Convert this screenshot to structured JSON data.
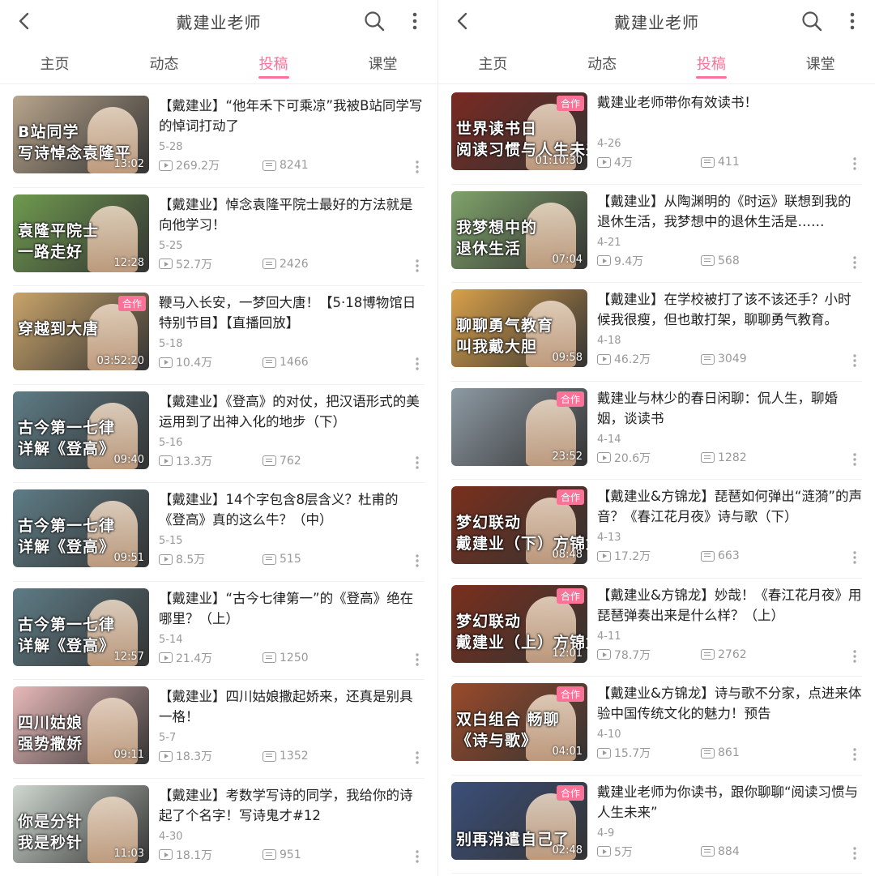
{
  "panels": [
    {
      "header": {
        "title": "戴建业老师"
      },
      "tabs": [
        "主页",
        "动态",
        "投稿",
        "课堂"
      ],
      "active_tab": 2,
      "videos": [
        {
          "title": "【戴建业】“他年禾下可乘凉”我被B站同学写的悼词打动了",
          "date": "5-28",
          "views": "269.2万",
          "danmaku": "8241",
          "duration": "13:02",
          "coop": "",
          "overlay1": "B站同学",
          "overlay2": "写诗悼念袁隆平",
          "bg": "#b8a58c"
        },
        {
          "title": "【戴建业】悼念袁隆平院士最好的方法就是向他学习！",
          "date": "5-25",
          "views": "52.7万",
          "danmaku": "2426",
          "duration": "12:28",
          "coop": "",
          "overlay1": "袁隆平院士",
          "overlay2": "一路走好",
          "bg": "#6f9a4f"
        },
        {
          "title": "鞭马入长安，一梦回大唐！【5·18博物馆日特别节目】【直播回放】",
          "date": "5-18",
          "views": "10.4万",
          "danmaku": "1466",
          "duration": "03:52:20",
          "coop": "合作",
          "overlay1": "穿越到大唐",
          "overlay2": "",
          "bg": "#c9a46a"
        },
        {
          "title": "【戴建业】《登高》的对仗，把汉语形式的美运用到了出神入化的地步（下）",
          "date": "5-16",
          "views": "13.3万",
          "danmaku": "762",
          "duration": "09:40",
          "coop": "",
          "overlay1": "古今第一七律",
          "overlay2": "详解《登高》",
          "bg": "#5e7c86"
        },
        {
          "title": "【戴建业】14个字包含8层含义？杜甫的《登高》真的这么牛？（中）",
          "date": "5-15",
          "views": "8.5万",
          "danmaku": "515",
          "duration": "09:51",
          "coop": "",
          "overlay1": "古今第一七律",
          "overlay2": "详解《登高》",
          "bg": "#5e7c86"
        },
        {
          "title": "【戴建业】“古今七律第一”的《登高》绝在哪里？（上）",
          "date": "5-14",
          "views": "21.4万",
          "danmaku": "1250",
          "duration": "12:57",
          "coop": "",
          "overlay1": "古今第一七律",
          "overlay2": "详解《登高》",
          "bg": "#5e7c86"
        },
        {
          "title": "【戴建业】四川姑娘撒起娇来，还真是别具一格！",
          "date": "5-7",
          "views": "18.3万",
          "danmaku": "1352",
          "duration": "09:11",
          "coop": "",
          "overlay1": "四川姑娘",
          "overlay2": "强势撒娇",
          "bg": "#e8b9b9"
        },
        {
          "title": "【戴建业】考数学写诗的同学，我给你的诗起了个名字！写诗鬼才#12",
          "date": "4-30",
          "views": "18.1万",
          "danmaku": "951",
          "duration": "11:03",
          "coop": "",
          "overlay1": "你是分针",
          "overlay2": "我是秒针",
          "bg": "#cfd8d0"
        }
      ]
    },
    {
      "header": {
        "title": "戴建业老师"
      },
      "tabs": [
        "主页",
        "动态",
        "投稿",
        "课堂"
      ],
      "active_tab": 2,
      "videos": [
        {
          "title": "戴建业老师带你有效读书！",
          "date": "4-26",
          "views": "4万",
          "danmaku": "411",
          "duration": "01:10:30",
          "coop": "合作",
          "overlay1": "世界读书日",
          "overlay2": "阅读习惯与人生未来",
          "bg": "#7a2a22"
        },
        {
          "title": "【戴建业】从陶渊明的《时运》联想到我的退休生活，我梦想中的退休生活是……",
          "date": "4-21",
          "views": "9.4万",
          "danmaku": "568",
          "duration": "07:04",
          "coop": "",
          "overlay1": "我梦想中的",
          "overlay2": "退休生活",
          "bg": "#7fa36a"
        },
        {
          "title": "【戴建业】在学校被打了该不该还手？小时候我很瘦，但也敢打架，聊聊勇气教育。",
          "date": "4-18",
          "views": "46.2万",
          "danmaku": "3049",
          "duration": "09:58",
          "coop": "",
          "overlay1": "聊聊勇气教育",
          "overlay2": "叫我戴大胆",
          "bg": "#d9a04a"
        },
        {
          "title": "戴建业与林少的春日闲聊：侃人生，聊婚姻，谈读书",
          "date": "4-14",
          "views": "20.6万",
          "danmaku": "1282",
          "duration": "23:52",
          "coop": "合作",
          "overlay1": "",
          "overlay2": "",
          "bg": "#8d9aa3"
        },
        {
          "title": "【戴建业&方锦龙】琵琶如何弹出“涟漪”的声音？《春江花月夜》诗与歌（下）",
          "date": "4-13",
          "views": "17.2万",
          "danmaku": "663",
          "duration": "08:48",
          "coop": "合作",
          "overlay1": "梦幻联动",
          "overlay2": "戴建业（下）方锦龙",
          "bg": "#7a2f1c"
        },
        {
          "title": "【戴建业&方锦龙】妙哉！《春江花月夜》用琵琶弹奏出来是什么样？（上）",
          "date": "4-11",
          "views": "78.7万",
          "danmaku": "2762",
          "duration": "12:01",
          "coop": "合作",
          "overlay1": "梦幻联动",
          "overlay2": "戴建业（上）方锦龙",
          "bg": "#7a2f1c"
        },
        {
          "title": "【戴建业&方锦龙】诗与歌不分家，点进来体验中国传统文化的魅力！预告",
          "date": "4-10",
          "views": "15.7万",
          "danmaku": "861",
          "duration": "04:01",
          "coop": "合作",
          "overlay1": "双白组合 畅聊",
          "overlay2": "《诗与歌》",
          "bg": "#9a4a2a"
        },
        {
          "title": "戴建业老师为你读书，跟你聊聊“阅读习惯与人生未来”",
          "date": "4-9",
          "views": "5万",
          "danmaku": "884",
          "duration": "02:48",
          "coop": "合作",
          "overlay1": "",
          "overlay2": "别再消遣自己了",
          "bg": "#3b4f7a"
        }
      ]
    }
  ],
  "colors": {
    "accent": "#fb7299",
    "meta": "#999999",
    "text": "#222222"
  },
  "icons": {
    "back": "chevron-left-icon",
    "search": "search-icon",
    "more": "more-vertical-icon",
    "views": "play-count-icon",
    "danmaku": "danmaku-icon",
    "item_more": "more-vertical-icon"
  }
}
